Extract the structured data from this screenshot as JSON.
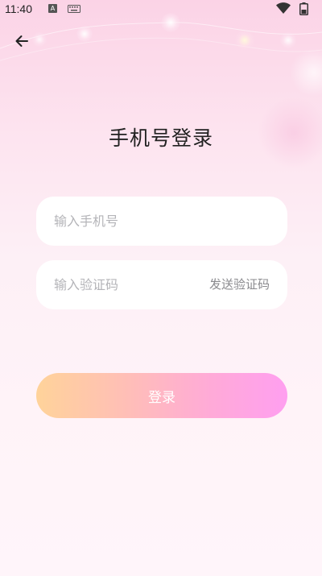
{
  "status_bar": {
    "time": "11:40",
    "a_icon": "A",
    "icons": [
      "a-badge-icon",
      "keyboard-icon",
      "wifi-icon",
      "battery-icon"
    ]
  },
  "header": {
    "back_icon": "arrow-left-icon"
  },
  "title": "手机号登录",
  "phone_field": {
    "value": "",
    "placeholder": "输入手机号"
  },
  "code_field": {
    "value": "",
    "placeholder": "输入验证码",
    "send_label": "发送验证码"
  },
  "login_button": {
    "label": "登录"
  },
  "colors": {
    "background_top": "#fbd3e6",
    "background_bottom": "#fff5fa",
    "button_gradient_start": "#ffd39a",
    "button_gradient_end": "#ff9ff0",
    "title": "#222222",
    "placeholder": "#b4b4b8",
    "send_code": "#8a8a8e"
  }
}
